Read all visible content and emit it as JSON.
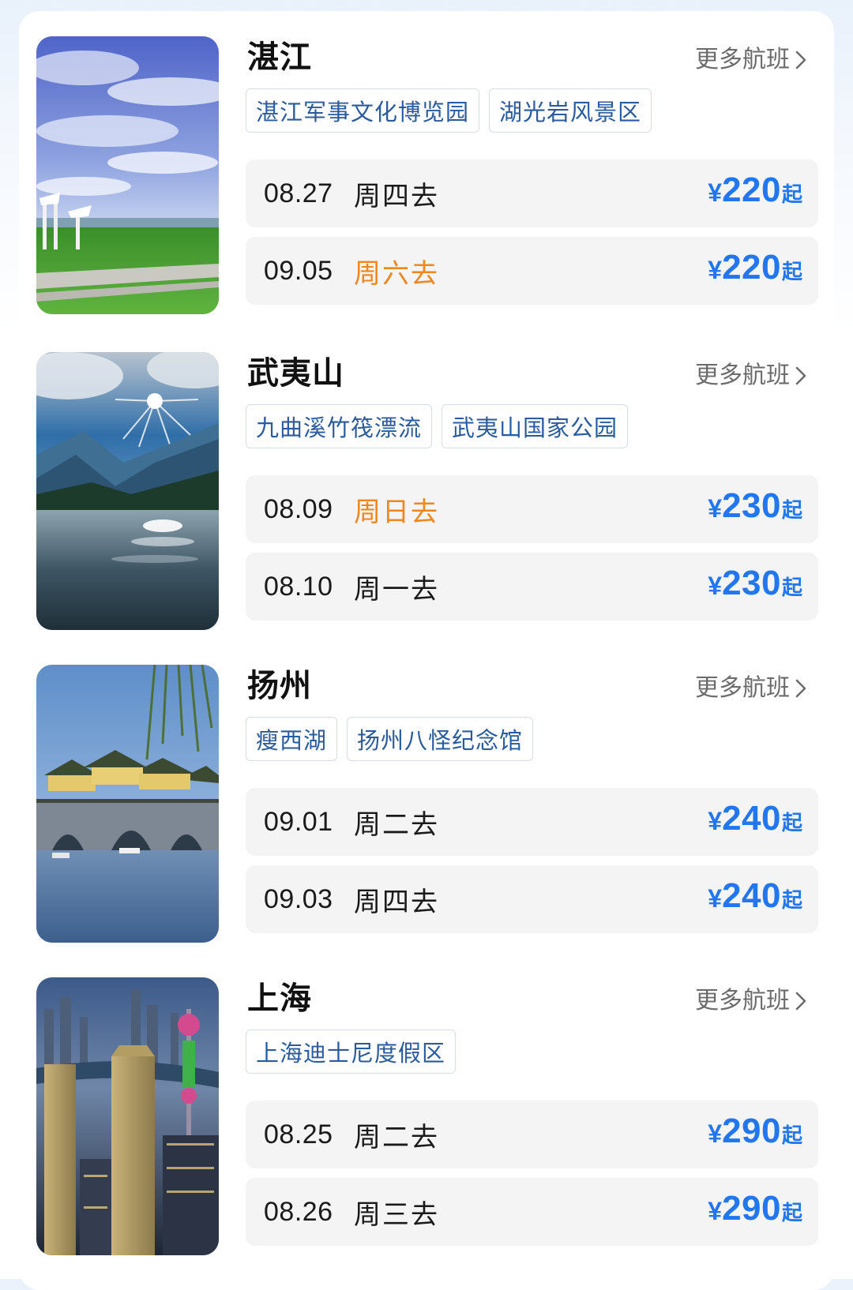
{
  "destinations": [
    {
      "name": "湛江",
      "more_label": "更多航班",
      "image": "zhanjiang-coast-photo",
      "tags": [
        "湛江军事文化博览园",
        "湖光岩风景区"
      ],
      "flights": [
        {
          "date": "08.27",
          "day": "周四去",
          "weekend": false,
          "currency": "¥",
          "price": "220",
          "suffix": "起"
        },
        {
          "date": "09.05",
          "day": "周六去",
          "weekend": true,
          "currency": "¥",
          "price": "220",
          "suffix": "起"
        }
      ]
    },
    {
      "name": "武夷山",
      "more_label": "更多航班",
      "image": "wuyishan-mountain-lake-photo",
      "tags": [
        "九曲溪竹筏漂流",
        "武夷山国家公园"
      ],
      "flights": [
        {
          "date": "08.09",
          "day": "周日去",
          "weekend": true,
          "currency": "¥",
          "price": "230",
          "suffix": "起"
        },
        {
          "date": "08.10",
          "day": "周一去",
          "weekend": false,
          "currency": "¥",
          "price": "230",
          "suffix": "起"
        }
      ]
    },
    {
      "name": "扬州",
      "more_label": "更多航班",
      "image": "yangzhou-five-pavilion-bridge-photo",
      "tags": [
        "瘦西湖",
        "扬州八怪纪念馆"
      ],
      "flights": [
        {
          "date": "09.01",
          "day": "周二去",
          "weekend": false,
          "currency": "¥",
          "price": "240",
          "suffix": "起"
        },
        {
          "date": "09.03",
          "day": "周四去",
          "weekend": false,
          "currency": "¥",
          "price": "240",
          "suffix": "起"
        }
      ]
    },
    {
      "name": "上海",
      "more_label": "更多航班",
      "image": "shanghai-skyline-night-photo",
      "tags": [
        "上海迪士尼度假区"
      ],
      "flights": [
        {
          "date": "08.25",
          "day": "周二去",
          "weekend": false,
          "currency": "¥",
          "price": "290",
          "suffix": "起"
        },
        {
          "date": "08.26",
          "day": "周三去",
          "weekend": false,
          "currency": "¥",
          "price": "290",
          "suffix": "起"
        }
      ]
    }
  ],
  "colors": {
    "price": "#2277f0",
    "weekend_day": "#f0861e",
    "tag_text": "#2a5b9e",
    "row_background": "#f4f4f5"
  }
}
